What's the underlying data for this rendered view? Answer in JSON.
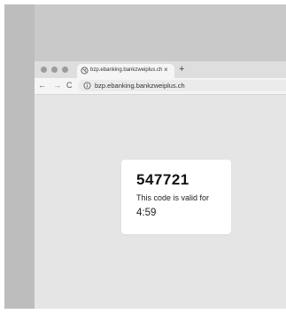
{
  "browser": {
    "tab": {
      "title": "bzp.ebanking.bankzweiplus.ch",
      "close": "×"
    },
    "new_tab": "+",
    "nav": {
      "back": "←",
      "forward": "→",
      "reload": "C"
    },
    "address_bar": {
      "url": "bzp.ebanking.bankzweiplus.ch"
    }
  },
  "code_card": {
    "code": "547721",
    "validity_label": "This code is valid for",
    "countdown": "4:59"
  }
}
